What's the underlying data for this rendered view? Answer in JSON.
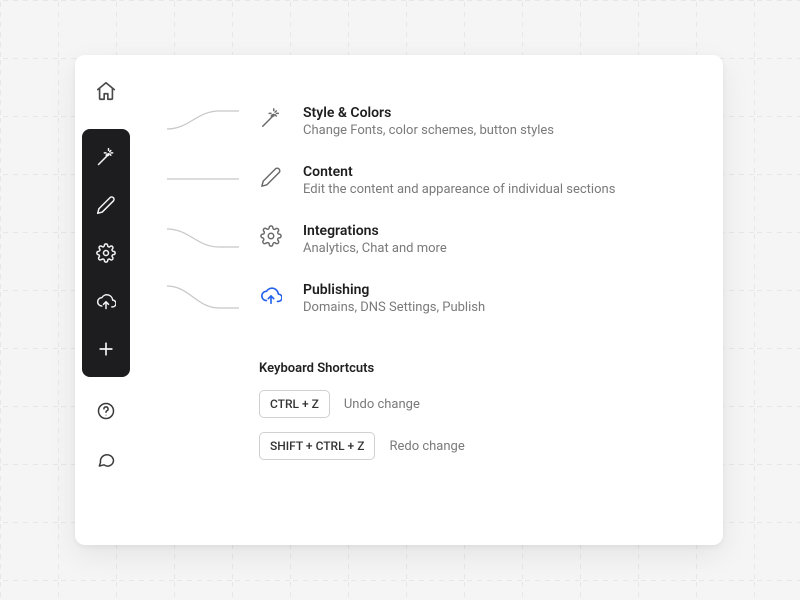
{
  "legend": [
    {
      "title": "Style & Colors",
      "desc": "Change Fonts, color schemes, button styles"
    },
    {
      "title": "Content",
      "desc": "Edit the content and appareance of individual sections"
    },
    {
      "title": "Integrations",
      "desc": "Analytics, Chat and more"
    },
    {
      "title": "Publishing",
      "desc": "Domains, DNS Settings, Publish"
    }
  ],
  "shortcuts": {
    "heading": "Keyboard Shortcuts",
    "items": [
      {
        "keys": "CTRL + Z",
        "label": "Undo change"
      },
      {
        "keys": "SHIFT + CTRL + Z",
        "label": "Redo change"
      }
    ]
  }
}
